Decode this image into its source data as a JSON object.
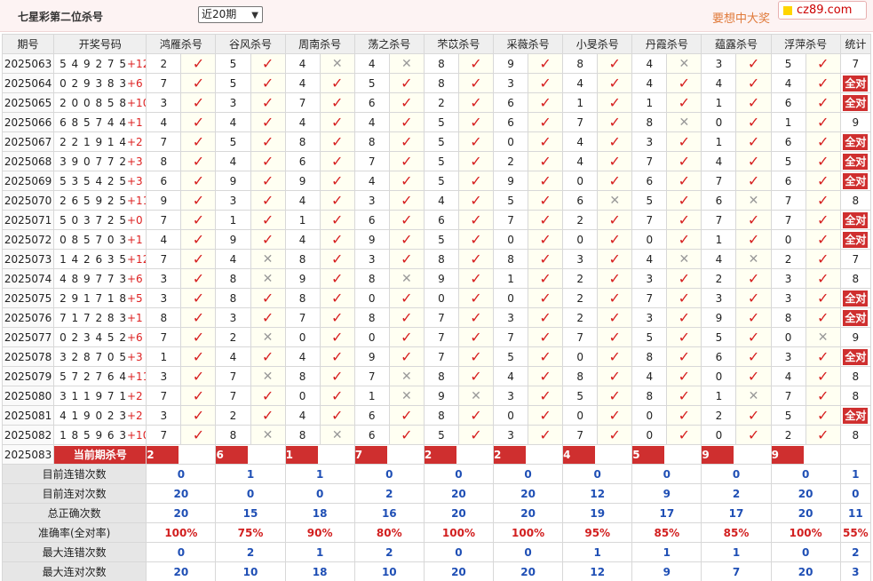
{
  "header": {
    "title": "七星彩第二位杀号",
    "range_select": "近20期",
    "ad_text": "要想中大奖",
    "logo_text": "cz89.com"
  },
  "columns": [
    "期号",
    "开奖号码",
    "鸿雁杀号",
    "谷风杀号",
    "周南杀号",
    "荡之杀号",
    "芣苡杀号",
    "采薇杀号",
    "小旻杀号",
    "丹霞杀号",
    "蕴露杀号",
    "浮萍杀号",
    "统计"
  ],
  "all_correct_label": "全对",
  "current_label": "当前期杀号",
  "rows": [
    {
      "period": "2025063",
      "digits": "549275",
      "plus": "+12",
      "picks": [
        [
          "2",
          1
        ],
        [
          "5",
          1
        ],
        [
          "4",
          0
        ],
        [
          "4",
          0
        ],
        [
          "8",
          1
        ],
        [
          "9",
          1
        ],
        [
          "8",
          1
        ],
        [
          "4",
          0
        ],
        [
          "3",
          1
        ],
        [
          "5",
          1
        ]
      ],
      "stat": "7"
    },
    {
      "period": "2025064",
      "digits": "029383",
      "plus": "+6",
      "picks": [
        [
          "7",
          1
        ],
        [
          "5",
          1
        ],
        [
          "4",
          1
        ],
        [
          "5",
          1
        ],
        [
          "8",
          1
        ],
        [
          "3",
          1
        ],
        [
          "4",
          1
        ],
        [
          "4",
          1
        ],
        [
          "4",
          1
        ],
        [
          "4",
          1
        ]
      ],
      "stat": "全对"
    },
    {
      "period": "2025065",
      "digits": "200858",
      "plus": "+10",
      "picks": [
        [
          "3",
          1
        ],
        [
          "3",
          1
        ],
        [
          "7",
          1
        ],
        [
          "6",
          1
        ],
        [
          "2",
          1
        ],
        [
          "6",
          1
        ],
        [
          "1",
          1
        ],
        [
          "1",
          1
        ],
        [
          "1",
          1
        ],
        [
          "6",
          1
        ]
      ],
      "stat": "全对"
    },
    {
      "period": "2025066",
      "digits": "685744",
      "plus": "+1",
      "picks": [
        [
          "4",
          1
        ],
        [
          "4",
          1
        ],
        [
          "4",
          1
        ],
        [
          "4",
          1
        ],
        [
          "5",
          1
        ],
        [
          "6",
          1
        ],
        [
          "7",
          1
        ],
        [
          "8",
          0
        ],
        [
          "0",
          1
        ],
        [
          "1",
          1
        ]
      ],
      "stat": "9"
    },
    {
      "period": "2025067",
      "digits": "221914",
      "plus": "+2",
      "picks": [
        [
          "7",
          1
        ],
        [
          "5",
          1
        ],
        [
          "8",
          1
        ],
        [
          "8",
          1
        ],
        [
          "5",
          1
        ],
        [
          "0",
          1
        ],
        [
          "4",
          1
        ],
        [
          "3",
          1
        ],
        [
          "1",
          1
        ],
        [
          "6",
          1
        ]
      ],
      "stat": "全对"
    },
    {
      "period": "2025068",
      "digits": "390772",
      "plus": "+3",
      "picks": [
        [
          "8",
          1
        ],
        [
          "4",
          1
        ],
        [
          "6",
          1
        ],
        [
          "7",
          1
        ],
        [
          "5",
          1
        ],
        [
          "2",
          1
        ],
        [
          "4",
          1
        ],
        [
          "7",
          1
        ],
        [
          "4",
          1
        ],
        [
          "5",
          1
        ]
      ],
      "stat": "全对"
    },
    {
      "period": "2025069",
      "digits": "535425",
      "plus": "+3",
      "picks": [
        [
          "6",
          1
        ],
        [
          "9",
          1
        ],
        [
          "9",
          1
        ],
        [
          "4",
          1
        ],
        [
          "5",
          1
        ],
        [
          "9",
          1
        ],
        [
          "0",
          1
        ],
        [
          "6",
          1
        ],
        [
          "7",
          1
        ],
        [
          "6",
          1
        ]
      ],
      "stat": "全对"
    },
    {
      "period": "2025070",
      "digits": "265925",
      "plus": "+11",
      "picks": [
        [
          "9",
          1
        ],
        [
          "3",
          1
        ],
        [
          "4",
          1
        ],
        [
          "3",
          1
        ],
        [
          "4",
          1
        ],
        [
          "5",
          1
        ],
        [
          "6",
          0
        ],
        [
          "5",
          1
        ],
        [
          "6",
          0
        ],
        [
          "7",
          1
        ]
      ],
      "stat": "8"
    },
    {
      "period": "2025071",
      "digits": "503725",
      "plus": "+0",
      "picks": [
        [
          "7",
          1
        ],
        [
          "1",
          1
        ],
        [
          "1",
          1
        ],
        [
          "6",
          1
        ],
        [
          "6",
          1
        ],
        [
          "7",
          1
        ],
        [
          "2",
          1
        ],
        [
          "7",
          1
        ],
        [
          "7",
          1
        ],
        [
          "7",
          1
        ]
      ],
      "stat": "全对"
    },
    {
      "period": "2025072",
      "digits": "085703",
      "plus": "+1",
      "picks": [
        [
          "4",
          1
        ],
        [
          "9",
          1
        ],
        [
          "4",
          1
        ],
        [
          "9",
          1
        ],
        [
          "5",
          1
        ],
        [
          "0",
          1
        ],
        [
          "0",
          1
        ],
        [
          "0",
          1
        ],
        [
          "1",
          1
        ],
        [
          "0",
          1
        ]
      ],
      "stat": "全对"
    },
    {
      "period": "2025073",
      "digits": "142635",
      "plus": "+12",
      "picks": [
        [
          "7",
          1
        ],
        [
          "4",
          0
        ],
        [
          "8",
          1
        ],
        [
          "3",
          1
        ],
        [
          "8",
          1
        ],
        [
          "8",
          1
        ],
        [
          "3",
          1
        ],
        [
          "4",
          0
        ],
        [
          "4",
          0
        ],
        [
          "2",
          1
        ]
      ],
      "stat": "7"
    },
    {
      "period": "2025074",
      "digits": "489773",
      "plus": "+6",
      "picks": [
        [
          "3",
          1
        ],
        [
          "8",
          0
        ],
        [
          "9",
          1
        ],
        [
          "8",
          0
        ],
        [
          "9",
          1
        ],
        [
          "1",
          1
        ],
        [
          "2",
          1
        ],
        [
          "3",
          1
        ],
        [
          "2",
          1
        ],
        [
          "3",
          1
        ]
      ],
      "stat": "8"
    },
    {
      "period": "2025075",
      "digits": "291718",
      "plus": "+5",
      "picks": [
        [
          "3",
          1
        ],
        [
          "8",
          1
        ],
        [
          "8",
          1
        ],
        [
          "0",
          1
        ],
        [
          "0",
          1
        ],
        [
          "0",
          1
        ],
        [
          "2",
          1
        ],
        [
          "7",
          1
        ],
        [
          "3",
          1
        ],
        [
          "3",
          1
        ]
      ],
      "stat": "全对"
    },
    {
      "period": "2025076",
      "digits": "717283",
      "plus": "+1",
      "picks": [
        [
          "8",
          1
        ],
        [
          "3",
          1
        ],
        [
          "7",
          1
        ],
        [
          "8",
          1
        ],
        [
          "7",
          1
        ],
        [
          "3",
          1
        ],
        [
          "2",
          1
        ],
        [
          "3",
          1
        ],
        [
          "9",
          1
        ],
        [
          "8",
          1
        ]
      ],
      "stat": "全对"
    },
    {
      "period": "2025077",
      "digits": "023452",
      "plus": "+6",
      "picks": [
        [
          "7",
          1
        ],
        [
          "2",
          0
        ],
        [
          "0",
          1
        ],
        [
          "0",
          1
        ],
        [
          "7",
          1
        ],
        [
          "7",
          1
        ],
        [
          "7",
          1
        ],
        [
          "5",
          1
        ],
        [
          "5",
          1
        ],
        [
          "0",
          0
        ]
      ],
      "stat": "9"
    },
    {
      "period": "2025078",
      "digits": "328705",
      "plus": "+3",
      "picks": [
        [
          "1",
          1
        ],
        [
          "4",
          1
        ],
        [
          "4",
          1
        ],
        [
          "9",
          1
        ],
        [
          "7",
          1
        ],
        [
          "5",
          1
        ],
        [
          "0",
          1
        ],
        [
          "8",
          1
        ],
        [
          "6",
          1
        ],
        [
          "3",
          1
        ]
      ],
      "stat": "全对"
    },
    {
      "period": "2025079",
      "digits": "572764",
      "plus": "+11",
      "picks": [
        [
          "3",
          1
        ],
        [
          "7",
          0
        ],
        [
          "8",
          1
        ],
        [
          "7",
          0
        ],
        [
          "8",
          1
        ],
        [
          "4",
          1
        ],
        [
          "8",
          1
        ],
        [
          "4",
          1
        ],
        [
          "0",
          1
        ],
        [
          "4",
          1
        ]
      ],
      "stat": "8"
    },
    {
      "period": "2025080",
      "digits": "311971",
      "plus": "+2",
      "picks": [
        [
          "7",
          1
        ],
        [
          "7",
          1
        ],
        [
          "0",
          1
        ],
        [
          "1",
          0
        ],
        [
          "9",
          0
        ],
        [
          "3",
          1
        ],
        [
          "5",
          1
        ],
        [
          "8",
          1
        ],
        [
          "1",
          0
        ],
        [
          "7",
          1
        ]
      ],
      "stat": "8"
    },
    {
      "period": "2025081",
      "digits": "419023",
      "plus": "+2",
      "picks": [
        [
          "3",
          1
        ],
        [
          "2",
          1
        ],
        [
          "4",
          1
        ],
        [
          "6",
          1
        ],
        [
          "8",
          1
        ],
        [
          "0",
          1
        ],
        [
          "0",
          1
        ],
        [
          "0",
          1
        ],
        [
          "2",
          1
        ],
        [
          "5",
          1
        ]
      ],
      "stat": "全对"
    },
    {
      "period": "2025082",
      "digits": "185963",
      "plus": "+10",
      "picks": [
        [
          "7",
          1
        ],
        [
          "8",
          0
        ],
        [
          "8",
          0
        ],
        [
          "6",
          1
        ],
        [
          "5",
          1
        ],
        [
          "3",
          1
        ],
        [
          "7",
          1
        ],
        [
          "0",
          1
        ],
        [
          "0",
          1
        ],
        [
          "2",
          1
        ]
      ],
      "stat": "8"
    }
  ],
  "current": {
    "period": "2025083",
    "picks": [
      "2",
      "6",
      "1",
      "7",
      "2",
      "2",
      "4",
      "5",
      "9",
      "9"
    ]
  },
  "stats": [
    {
      "label": "目前连错次数",
      "values": [
        "0",
        "1",
        "1",
        "0",
        "0",
        "0",
        "0",
        "0",
        "0",
        "0",
        "1"
      ],
      "red": false
    },
    {
      "label": "目前连对次数",
      "values": [
        "20",
        "0",
        "0",
        "2",
        "20",
        "20",
        "12",
        "9",
        "2",
        "20",
        "0"
      ],
      "red": false
    },
    {
      "label": "总正确次数",
      "values": [
        "20",
        "15",
        "18",
        "16",
        "20",
        "20",
        "19",
        "17",
        "17",
        "20",
        "11"
      ],
      "red": false
    },
    {
      "label": "准确率(全对率)",
      "values": [
        "100%",
        "75%",
        "90%",
        "80%",
        "100%",
        "100%",
        "95%",
        "85%",
        "85%",
        "100%",
        "55%"
      ],
      "red": true
    },
    {
      "label": "最大连错次数",
      "values": [
        "0",
        "2",
        "1",
        "2",
        "0",
        "0",
        "1",
        "1",
        "1",
        "0",
        "2"
      ],
      "red": false
    },
    {
      "label": "最大连对次数",
      "values": [
        "20",
        "10",
        "18",
        "10",
        "20",
        "20",
        "12",
        "9",
        "7",
        "20",
        "3"
      ],
      "red": false
    }
  ]
}
